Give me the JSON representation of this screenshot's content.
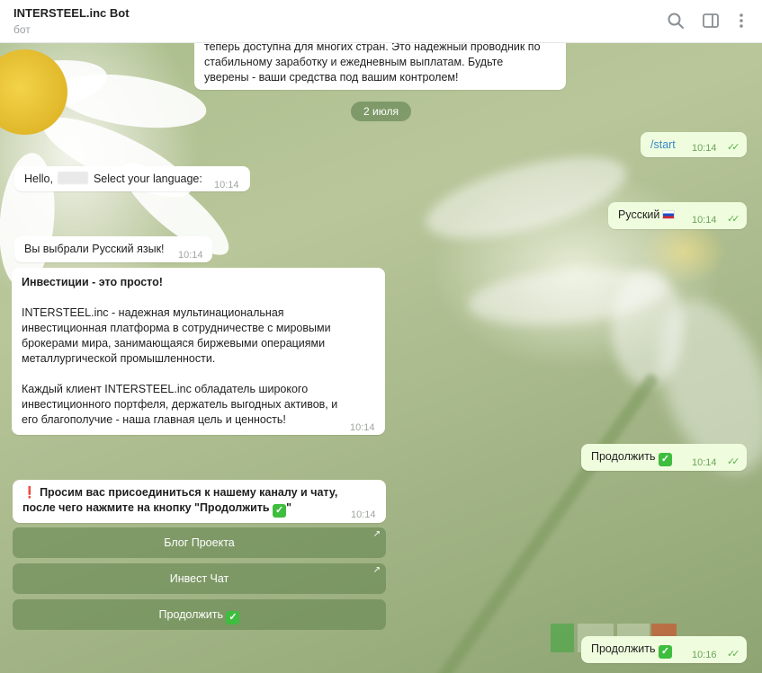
{
  "header": {
    "title": "INTERSTEEL.inc Bot",
    "subtitle": "бот",
    "icons": [
      "search-icon",
      "sidebar-icon",
      "more-icon"
    ]
  },
  "messages": {
    "top_partial": {
      "line1": "теперь доступна для многих стран. Это надежный проводник по",
      "line2": "стабильному заработку и ежедневным выплатам. Будьте",
      "line3": "уверены - ваши средства под вашим контролем!"
    },
    "date_separator": "2 июля",
    "start": {
      "text": "/start",
      "time": "10:14"
    },
    "hello": {
      "text_before": "Hello,",
      "text_after": "Select your language:",
      "time": "10:14"
    },
    "russian": {
      "text": "Русский",
      "time": "10:14"
    },
    "chosen": {
      "text": "Вы выбрали Русский язык!",
      "time": "10:14"
    },
    "invest": {
      "heading": "Инвестиции - это просто!",
      "p1": [
        "INTERSTEEL.inc - надежная мультинациональная",
        "инвестиционная платформа в сотрудничестве с мировыми",
        "брокерами мира, занимающаяся биржевыми операциями",
        "металлургической промышленности."
      ],
      "p2": [
        "Каждый клиент INTERSTEEL.inc обладатель широкого",
        "инвестиционного портфеля, держатель выгодных активов, и",
        "его благополучие - наша главная цель и ценность!"
      ],
      "time": "10:14"
    },
    "continue1": {
      "text": "Продолжить",
      "time": "10:14"
    },
    "join": {
      "mark": "❗",
      "line1": "Просим вас присоединиться к нашему каналу и чату,",
      "line2": "после чего нажмите на кнопку \"Продолжить",
      "line2_end": "\"",
      "time": "10:14"
    },
    "continue2": {
      "text": "Продолжить",
      "time": "10:16"
    }
  },
  "keyboard": {
    "blog": "Блог Проекта",
    "chat": "Инвест Чат",
    "continue": "Продолжить"
  },
  "colors": {
    "outgoing": "#effdde",
    "incoming": "#ffffff",
    "pill": "#6e8c5a",
    "checkmark": "#3ebd3e"
  }
}
